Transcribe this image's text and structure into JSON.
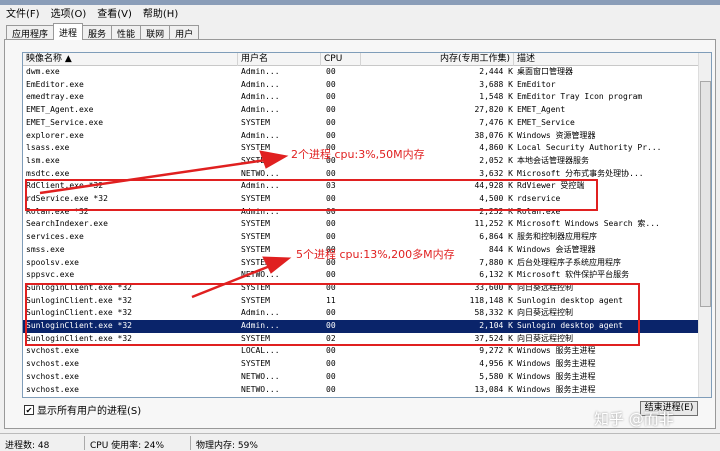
{
  "menu": [
    "文件(F)",
    "选项(O)",
    "查看(V)",
    "帮助(H)"
  ],
  "tabs": [
    {
      "label": "应用程序",
      "active": false
    },
    {
      "label": "进程",
      "active": true
    },
    {
      "label": "服务",
      "active": false
    },
    {
      "label": "性能",
      "active": false
    },
    {
      "label": "联网",
      "active": false
    },
    {
      "label": "用户",
      "active": false
    }
  ],
  "columns": {
    "name": "映像名称 ▲",
    "user": "用户名",
    "cpu": "CPU",
    "mem": "内存(专用工作集)",
    "desc": "描述"
  },
  "rows": [
    {
      "name": "dwm.exe",
      "user": "Admin...",
      "cpu": "00",
      "mem": "2,444 K",
      "desc": "桌面窗口管理器"
    },
    {
      "name": "EmEditor.exe",
      "user": "Admin...",
      "cpu": "00",
      "mem": "3,688 K",
      "desc": "EmEditor"
    },
    {
      "name": "emedtray.exe",
      "user": "Admin...",
      "cpu": "00",
      "mem": "1,548 K",
      "desc": "EmEditor Tray Icon program"
    },
    {
      "name": "EMET_Agent.exe",
      "user": "Admin...",
      "cpu": "00",
      "mem": "27,820 K",
      "desc": "EMET_Agent"
    },
    {
      "name": "EMET_Service.exe",
      "user": "SYSTEM",
      "cpu": "00",
      "mem": "7,476 K",
      "desc": "EMET_Service"
    },
    {
      "name": "explorer.exe",
      "user": "Admin...",
      "cpu": "00",
      "mem": "38,076 K",
      "desc": "Windows 资源管理器"
    },
    {
      "name": "lsass.exe",
      "user": "SYSTEM",
      "cpu": "00",
      "mem": "4,860 K",
      "desc": "Local Security Authority Pr..."
    },
    {
      "name": "lsm.exe",
      "user": "SYSTEM",
      "cpu": "00",
      "mem": "2,052 K",
      "desc": "本地会话管理器服务"
    },
    {
      "name": "msdtc.exe",
      "user": "NETWO...",
      "cpu": "00",
      "mem": "3,632 K",
      "desc": "Microsoft 分布式事务处理协..."
    },
    {
      "name": "RdClient.exe *32",
      "user": "Admin...",
      "cpu": "03",
      "mem": "44,928 K",
      "desc": "RdViewer 受控端"
    },
    {
      "name": "rdService.exe *32",
      "user": "SYSTEM",
      "cpu": "00",
      "mem": "4,500 K",
      "desc": "rdservice"
    },
    {
      "name": "Rolan.exe *32",
      "user": "Admin...",
      "cpu": "00",
      "mem": "2,252 K",
      "desc": "Rolan.exe"
    },
    {
      "name": "SearchIndexer.exe",
      "user": "SYSTEM",
      "cpu": "00",
      "mem": "11,252 K",
      "desc": "Microsoft Windows Search 索..."
    },
    {
      "name": "services.exe",
      "user": "SYSTEM",
      "cpu": "00",
      "mem": "6,864 K",
      "desc": "服务和控制器应用程序"
    },
    {
      "name": "smss.exe",
      "user": "SYSTEM",
      "cpu": "00",
      "mem": "844 K",
      "desc": "Windows 会话管理器"
    },
    {
      "name": "spoolsv.exe",
      "user": "SYSTEM",
      "cpu": "00",
      "mem": "7,880 K",
      "desc": "后台处理程序子系统应用程序"
    },
    {
      "name": "sppsvc.exe",
      "user": "NETWO...",
      "cpu": "00",
      "mem": "6,132 K",
      "desc": "Microsoft 软件保护平台服务"
    },
    {
      "name": "SunloginClient.exe *32",
      "user": "SYSTEM",
      "cpu": "00",
      "mem": "33,600 K",
      "desc": "向日葵远程控制"
    },
    {
      "name": "SunloginClient.exe *32",
      "user": "SYSTEM",
      "cpu": "11",
      "mem": "118,148 K",
      "desc": "Sunlogin desktop agent"
    },
    {
      "name": "SunloginClient.exe *32",
      "user": "Admin...",
      "cpu": "00",
      "mem": "58,332 K",
      "desc": "向日葵远程控制"
    },
    {
      "name": "SunloginClient.exe *32",
      "user": "Admin...",
      "cpu": "00",
      "mem": "2,104 K",
      "desc": "Sunlogin desktop agent",
      "selected": true
    },
    {
      "name": "SunloginClient.exe *32",
      "user": "SYSTEM",
      "cpu": "02",
      "mem": "37,524 K",
      "desc": "向日葵远程控制"
    },
    {
      "name": "svchost.exe",
      "user": "LOCAL...",
      "cpu": "00",
      "mem": "9,272 K",
      "desc": "Windows 服务主进程"
    },
    {
      "name": "svchost.exe",
      "user": "SYSTEM",
      "cpu": "00",
      "mem": "4,956 K",
      "desc": "Windows 服务主进程"
    },
    {
      "name": "svchost.exe",
      "user": "NETWO...",
      "cpu": "00",
      "mem": "5,580 K",
      "desc": "Windows 服务主进程"
    },
    {
      "name": "svchost.exe",
      "user": "NETWO...",
      "cpu": "00",
      "mem": "13,084 K",
      "desc": "Windows 服务主进程"
    }
  ],
  "annotations": {
    "top": "2个进程 cpu:3%,50M内存",
    "bottom": "5个进程 cpu:13%,200多M内存",
    "color": "#e02020"
  },
  "show_all_label": "显示所有用户的进程(S)",
  "show_all_checked": true,
  "end_process_label": "结束进程(E)",
  "watermark": "知乎 @而非",
  "status": {
    "processes": "进程数: 48",
    "cpu": "CPU 使用率: 24%",
    "memory": "物理内存: 59%"
  },
  "selection_color": "#0a246a"
}
